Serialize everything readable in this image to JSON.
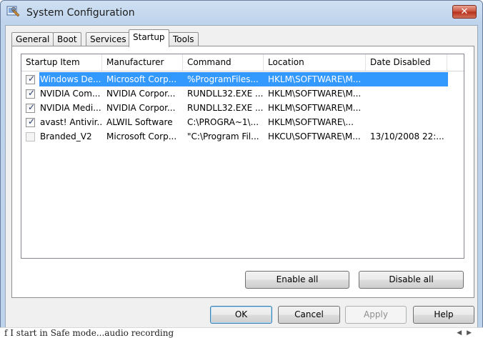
{
  "window": {
    "title": "System Configuration",
    "close_glyph": "✕"
  },
  "icons": {
    "app": "system-configuration-icon",
    "close": "close-icon"
  },
  "tabs": [
    {
      "label": "General"
    },
    {
      "label": "Boot"
    },
    {
      "label": "Services"
    },
    {
      "label": "Startup",
      "active": true
    },
    {
      "label": "Tools"
    }
  ],
  "startup": {
    "columns": [
      "Startup Item",
      "Manufacturer",
      "Command",
      "Location",
      "Date Disabled"
    ],
    "rows": [
      {
        "checked": true,
        "selected": true,
        "item": "Windows De...",
        "manufacturer": "Microsoft Corp...",
        "command": "%ProgramFiles...",
        "location": "HKLM\\SOFTWARE\\M...",
        "date": ""
      },
      {
        "checked": true,
        "selected": false,
        "item": "NVIDIA Com...",
        "manufacturer": "NVIDIA Corpor...",
        "command": "RUNDLL32.EXE ...",
        "location": "HKLM\\SOFTWARE\\M...",
        "date": ""
      },
      {
        "checked": true,
        "selected": false,
        "item": "NVIDIA Medi...",
        "manufacturer": "NVIDIA Corpor...",
        "command": "RUNDLL32.EXE ...",
        "location": "HKLM\\SOFTWARE\\M...",
        "date": ""
      },
      {
        "checked": true,
        "selected": false,
        "item": "avast! Antivir...",
        "manufacturer": "ALWIL Software",
        "command": "C:\\PROGRA~1\\...",
        "location": "HKLM\\SOFTWARE\\...",
        "date": ""
      },
      {
        "checked": false,
        "selected": false,
        "item": "Branded_V2",
        "manufacturer": "Microsoft Corp...",
        "command": "\"C:\\Program Fil...",
        "location": "HKCU\\SOFTWARE\\M...",
        "date": "13/10/2008 22:..."
      }
    ],
    "enable_all": "Enable all",
    "disable_all": "Disable all"
  },
  "footer": {
    "ok": "OK",
    "cancel": "Cancel",
    "apply": "Apply",
    "help": "Help"
  },
  "background": {
    "text": "f I start in Safe mode...audio recording",
    "controls": "◀ ▶"
  },
  "colors": {
    "selection": "#3399ff",
    "title_bg": "#bfd4ed",
    "close": "#c9503b"
  }
}
